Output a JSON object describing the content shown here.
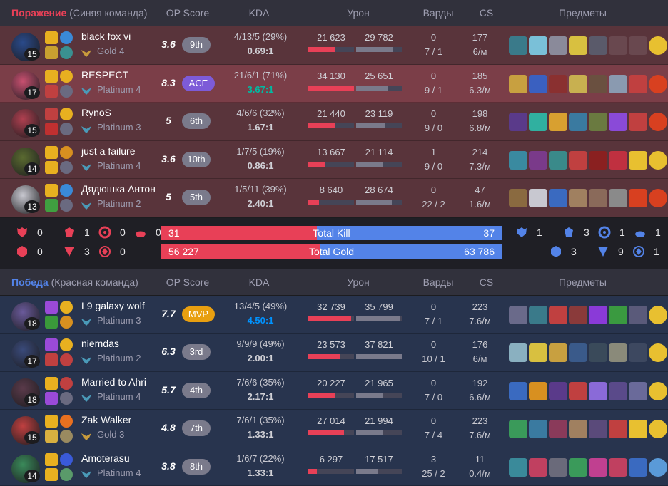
{
  "header_cols": {
    "op_score": "OP Score",
    "kda": "KDA",
    "damage": "Урон",
    "wards": "Варды",
    "cs": "CS",
    "items": "Предметы"
  },
  "team_loss": {
    "result": "Поражение",
    "name": "(Синяя команда)",
    "players": [
      {
        "name": "black fox vi",
        "rank": "Gold 4",
        "score": "3.6",
        "badge": "9th",
        "kda": "4/13/5 (29%)",
        "ratio": "0.69:1",
        "dealt": "21 623",
        "dealt_pct": 0.6,
        "taken": "29 782",
        "taken_pct": 0.82,
        "wards": "0",
        "wards2": "7 / 1",
        "cs": "177",
        "csm": "6/м",
        "level": "15",
        "colors": [
          "#2a4a8a",
          "#e8b020",
          "#3a8ad8",
          "#c8a030",
          "#3a9090"
        ],
        "items": [
          "#3a7a8a",
          "#7ac0d8",
          "#8a8a9a",
          "#d8c040",
          "#5a5a6a",
          "empty",
          "empty"
        ],
        "ward_color": "#e8c030"
      },
      {
        "name": "RESPECT",
        "rank": "Platinum 4",
        "score": "8.3",
        "badge": "ACE",
        "kda": "21/6/1 (71%)",
        "ratio": "3.67:1",
        "dealt": "34 130",
        "dealt_pct": 1.0,
        "taken": "25 651",
        "taken_pct": 0.7,
        "wards": "0",
        "wards2": "9 / 1",
        "cs": "185",
        "csm": "6.3/м",
        "level": "17",
        "colors": [
          "#c85070",
          "#e8b020",
          "#e8b020",
          "#c04040",
          "#6a6a80"
        ],
        "items": [
          "#c8a040",
          "#3a60c0",
          "#8a3030",
          "#c8b050",
          "#6a5040",
          "#8a9ab0",
          "#c04040"
        ],
        "ward_color": "#d84020"
      },
      {
        "name": "RynoS",
        "rank": "Platinum 3",
        "score": "5",
        "badge": "6th",
        "kda": "4/6/6 (32%)",
        "ratio": "1.67:1",
        "dealt": "21 440",
        "dealt_pct": 0.6,
        "taken": "23 119",
        "taken_pct": 0.64,
        "wards": "0",
        "wards2": "9 / 0",
        "cs": "198",
        "csm": "6.8/м",
        "level": "15",
        "colors": [
          "#b04050",
          "#c04040",
          "#e8b020",
          "#c03030",
          "#6a6a80"
        ],
        "items": [
          "#5a3a8a",
          "#30b0a0",
          "#d8a030",
          "#3a7aa0",
          "#6a7a40",
          "#8a4ad8",
          "#c04040"
        ],
        "ward_color": "#d84020"
      },
      {
        "name": "just a failure",
        "rank": "Platinum 4",
        "score": "3.6",
        "badge": "10th",
        "kda": "1/7/5 (19%)",
        "ratio": "0.86:1",
        "dealt": "13 667",
        "dealt_pct": 0.38,
        "taken": "21 114",
        "taken_pct": 0.58,
        "wards": "1",
        "wards2": "9 / 0",
        "cs": "214",
        "csm": "7.3/м",
        "level": "14",
        "colors": [
          "#5a6a30",
          "#e8b020",
          "#d89020",
          "#e8b020",
          "#6a6a80"
        ],
        "items": [
          "#3a8aa0",
          "#7a3a8a",
          "#3a8a8a",
          "#c04040",
          "#8a2020",
          "#c03040",
          "#e8c030"
        ],
        "ward_color": "#e8c030"
      },
      {
        "name": "Дядюшка Антон",
        "rank": "Platinum 2",
        "score": "5",
        "badge": "5th",
        "kda": "1/5/11 (39%)",
        "ratio": "2.40:1",
        "dealt": "8 640",
        "dealt_pct": 0.24,
        "taken": "28 674",
        "taken_pct": 0.78,
        "wards": "0",
        "wards2": "22 / 2",
        "cs": "47",
        "csm": "1.6/м",
        "level": "13",
        "colors": [
          "#c8c8d0",
          "#e8b020",
          "#3a8ad8",
          "#40a040",
          "#6a6a80"
        ],
        "items": [
          "#8a6a40",
          "#c8c8d0",
          "#3a6ac0",
          "#a08060",
          "#8a6a5a",
          "#8a8a8a",
          "#d84020"
        ],
        "ward_color": "#d84020"
      }
    ]
  },
  "summary": {
    "left_row1": [
      "0",
      "1",
      "0",
      "0"
    ],
    "left_row2": [
      "0",
      "3",
      "0"
    ],
    "right_row1": [
      "1",
      "3",
      "1",
      "1"
    ],
    "right_row2": [
      "3",
      "9",
      "1"
    ],
    "kills": {
      "label": "Total Kill",
      "left": "31",
      "right": "37",
      "left_pct": 0.456
    },
    "gold": {
      "label": "Total Gold",
      "left": "56 227",
      "right": "63 786",
      "left_pct": 0.468
    }
  },
  "team_win": {
    "result": "Победа",
    "name": "(Красная команда)",
    "players": [
      {
        "name": "L9 galaxy wolf",
        "rank": "Platinum 3",
        "score": "7.7",
        "badge": "MVP",
        "kda": "13/4/5 (49%)",
        "ratio": "4.50:1",
        "dealt": "32 739",
        "dealt_pct": 0.94,
        "taken": "35 799",
        "taken_pct": 0.95,
        "wards": "0",
        "wards2": "7 / 1",
        "cs": "223",
        "csm": "7.6/м",
        "level": "18",
        "colors": [
          "#6a5a9a",
          "#9a4ad8",
          "#e8b020",
          "#3a9a3a",
          "#d89020"
        ],
        "items": [
          "#6a6a8a",
          "#3a7a8a",
          "#c04040",
          "#8a3a3a",
          "#8a3ad8",
          "#3a9a40",
          "#5a5a7a"
        ],
        "ward_color": "#e8c030"
      },
      {
        "name": "niemdas",
        "rank": "Platinum 2",
        "score": "6.3",
        "badge": "3rd",
        "kda": "9/9/9 (49%)",
        "ratio": "2.00:1",
        "dealt": "23 573",
        "dealt_pct": 0.68,
        "taken": "37 821",
        "taken_pct": 1.0,
        "wards": "0",
        "wards2": "10 / 1",
        "cs": "176",
        "csm": "6/м",
        "level": "17",
        "colors": [
          "#3a4a7a",
          "#9a4ad8",
          "#e8b020",
          "#c04040",
          "#c04040"
        ],
        "items": [
          "#8ab0c0",
          "#d8c040",
          "#c8a040",
          "#3a5a8a",
          "#3a4a5a",
          "#8a8a7a",
          "empty"
        ],
        "ward_color": "#e8c030"
      },
      {
        "name": "Married to Ahri",
        "rank": "Platinum 4",
        "score": "5.7",
        "badge": "4th",
        "kda": "7/6/6 (35%)",
        "ratio": "2.17:1",
        "dealt": "20 227",
        "dealt_pct": 0.58,
        "taken": "21 965",
        "taken_pct": 0.6,
        "wards": "0",
        "wards2": "7 / 0",
        "cs": "192",
        "csm": "6.6/м",
        "level": "18",
        "colors": [
          "#5a3a4a",
          "#e8b020",
          "#c04040",
          "#9a4ad8",
          "#6a6a80"
        ],
        "items": [
          "#3a6ac0",
          "#d89020",
          "#5a3a8a",
          "#c04040",
          "#8a6ad8",
          "#5a4a8a",
          "#6a6a9a"
        ],
        "ward_color": "#e8c030"
      },
      {
        "name": "Zak Walker",
        "rank": "Gold 3",
        "score": "4.8",
        "badge": "7th",
        "kda": "7/6/1 (35%)",
        "ratio": "1.33:1",
        "dealt": "27 014",
        "dealt_pct": 0.78,
        "taken": "21 994",
        "taken_pct": 0.6,
        "wards": "0",
        "wards2": "7 / 4",
        "cs": "223",
        "csm": "7.6/м",
        "level": "15",
        "colors": [
          "#c04040",
          "#e8b020",
          "#e87020",
          "#d8b040",
          "#9a8a60"
        ],
        "items": [
          "#3a9a5a",
          "#3a7aa0",
          "#8a3a5a",
          "#a08060",
          "#5a4a7a",
          "#c04040",
          "#e8c030"
        ],
        "ward_color": "#e8c030"
      },
      {
        "name": "Amoterasu",
        "rank": "Platinum 4",
        "score": "3.8",
        "badge": "8th",
        "kda": "1/6/7 (22%)",
        "ratio": "1.33:1",
        "dealt": "6 297",
        "dealt_pct": 0.18,
        "taken": "17 517",
        "taken_pct": 0.48,
        "wards": "3",
        "wards2": "25 / 2",
        "cs": "11",
        "csm": "0.4/м",
        "level": "14",
        "colors": [
          "#3a8a5a",
          "#e8b020",
          "#3a5ad8",
          "#e8b020",
          "#5a9a6a"
        ],
        "items": [
          "#3a8a9a",
          "#c04060",
          "#6a6a7a",
          "#3a9a5a",
          "#c04090",
          "#c04060",
          "#3a6ac0"
        ],
        "ward_color": "#5a9ad8"
      }
    ]
  }
}
